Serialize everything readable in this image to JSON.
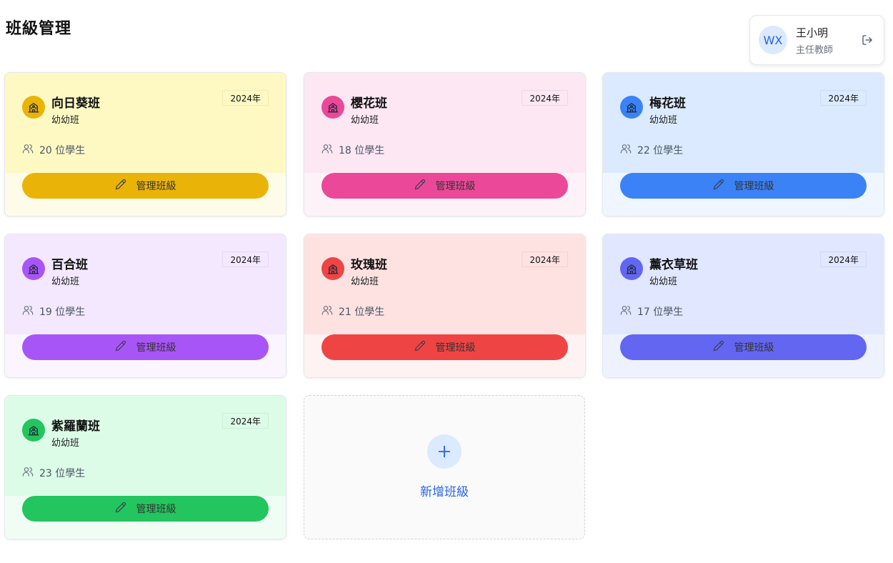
{
  "header": {
    "title": "班級管理"
  },
  "user": {
    "initials": "WX",
    "name": "王小明",
    "role": "主任教師"
  },
  "students_suffix": " 位學生",
  "manage_label": "管理班級",
  "add_label": "新增班級",
  "classes": [
    {
      "name": "向日葵班",
      "level": "幼幼班",
      "year": "2024年",
      "students": 20,
      "top_color": "#fef9c3",
      "bottom_color": "#fefce8",
      "accent": "#eab308"
    },
    {
      "name": "櫻花班",
      "level": "幼幼班",
      "year": "2024年",
      "students": 18,
      "top_color": "#fce7f3",
      "bottom_color": "#fdf2f8",
      "accent": "#ec4899"
    },
    {
      "name": "梅花班",
      "level": "幼幼班",
      "year": "2024年",
      "students": 22,
      "top_color": "#dbeafe",
      "bottom_color": "#eff6ff",
      "accent": "#3b82f6"
    },
    {
      "name": "百合班",
      "level": "幼幼班",
      "year": "2024年",
      "students": 19,
      "top_color": "#f3e8ff",
      "bottom_color": "#faf5ff",
      "accent": "#a855f7"
    },
    {
      "name": "玫瑰班",
      "level": "幼幼班",
      "year": "2024年",
      "students": 21,
      "top_color": "#fee2e2",
      "bottom_color": "#fef2f2",
      "accent": "#ef4444"
    },
    {
      "name": "薰衣草班",
      "level": "幼幼班",
      "year": "2024年",
      "students": 17,
      "top_color": "#e0e7ff",
      "bottom_color": "#eef2ff",
      "accent": "#6366f1"
    },
    {
      "name": "紫羅蘭班",
      "level": "幼幼班",
      "year": "2024年",
      "students": 23,
      "top_color": "#dcfce7",
      "bottom_color": "#f0fdf4",
      "accent": "#22c55e"
    }
  ]
}
